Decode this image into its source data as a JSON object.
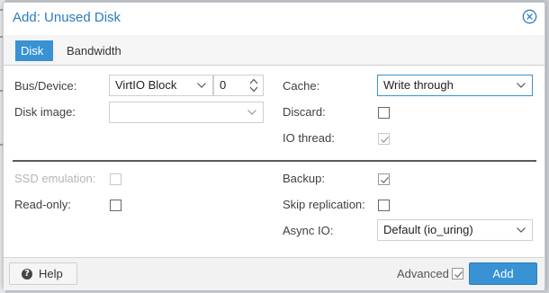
{
  "dialog": {
    "title": "Add: Unused Disk",
    "close_icon": "close-circle-icon"
  },
  "tabs": [
    {
      "label": "Disk",
      "active": true
    },
    {
      "label": "Bandwidth",
      "active": false
    }
  ],
  "left_fields": {
    "bus_device": {
      "label": "Bus/Device:",
      "bus_value": "VirtIO Block",
      "device_value": "0"
    },
    "disk_image": {
      "label": "Disk image:",
      "value": ""
    }
  },
  "right_fields": {
    "cache": {
      "label": "Cache:",
      "value": "Write through"
    },
    "discard": {
      "label": "Discard:",
      "checked": false
    },
    "io_thread": {
      "label": "IO thread:",
      "checked": true,
      "disabled": true
    }
  },
  "advanced_left": {
    "ssd_emulation": {
      "label": "SSD emulation:",
      "checked": false,
      "disabled": true
    },
    "read_only": {
      "label": "Read-only:",
      "checked": false
    }
  },
  "advanced_right": {
    "backup": {
      "label": "Backup:",
      "checked": true
    },
    "skip_replication": {
      "label": "Skip replication:",
      "checked": false
    },
    "async_io": {
      "label": "Async IO:",
      "value": "Default (io_uring)"
    }
  },
  "footer": {
    "help_label": "Help",
    "advanced_label": "Advanced",
    "advanced_checked": true,
    "add_label": "Add"
  },
  "colors": {
    "accent": "#3892d4",
    "title": "#2c7bc0",
    "disabled_text": "#b6b6b6"
  }
}
